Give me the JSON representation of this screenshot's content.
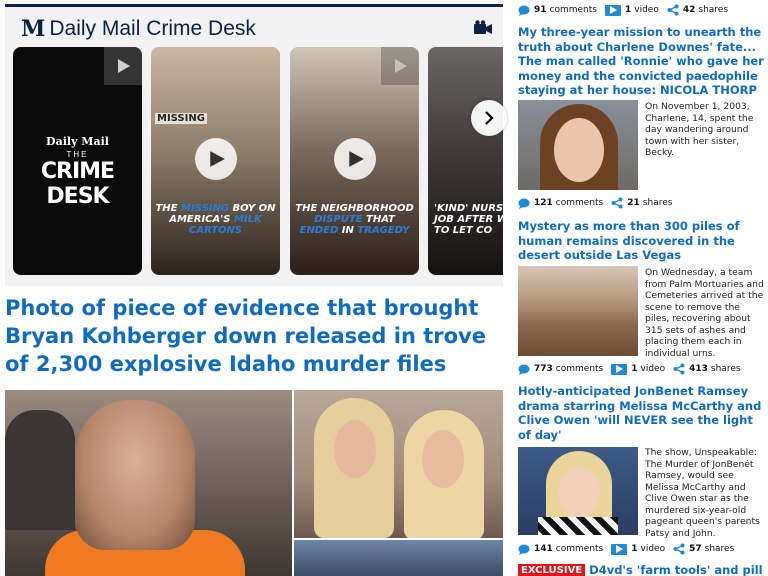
{
  "crime_desk": {
    "title": "Daily Mail Crime Desk",
    "logo_mark": "M",
    "cards": [
      {
        "logo_small": "Daily Mail",
        "logo_the": "THE",
        "logo_main": "CRIME DESK"
      },
      {
        "label_missing": "MISSING",
        "caption_pre": "THE ",
        "caption_hl": "MISSING",
        "caption_post": " BOY ON AMERICA'S ",
        "caption_hl2": "MILK CARTONS"
      },
      {
        "caption_pre": "THE NEIGHBORHOOD ",
        "caption_hl": "DISPUTE",
        "caption_mid": " THAT ",
        "caption_hl2": "ENDED",
        "caption_post": " IN ",
        "caption_hl3": "TRAGEDY"
      },
      {
        "caption_1": "'KIND' NURSE",
        "caption_2": "JOB AFTER W",
        "caption_3": "TO LET CO"
      }
    ]
  },
  "main_headline": "Photo of piece of evidence that brought Bryan Kohberger down released in trove of 2,300 explosive Idaho murder files",
  "sidebar": {
    "stories": [
      {
        "comments": "91",
        "comments_label": "comments",
        "videos": "1",
        "videos_label": "video",
        "shares": "42",
        "shares_label": "shares"
      },
      {
        "title": "My three-year mission to unearth the truth about Charlene Downes' fate... The man called 'Ronnie' who gave her money and the convicted paedophile staying at her house: NICOLA THORP",
        "desc": "On November 1, 2003, Charlene, 14, spent the day wandering around town with her sister, Becky.",
        "comments": "121",
        "comments_label": "comments",
        "shares": "21",
        "shares_label": "shares"
      },
      {
        "title": "Mystery as more than 300 piles of human remains discovered in the desert outside Las Vegas",
        "desc": "On Wednesday, a team from Palm Mortuaries and Cemeteries arrived at the scene to remove the piles, recovering about 315 sets of ashes and placing them each in individual urns.",
        "comments": "773",
        "comments_label": "comments",
        "videos": "1",
        "videos_label": "video",
        "shares": "413",
        "shares_label": "shares"
      },
      {
        "title": "Hotly-anticipated JonBenet Ramsey drama starring Melissa McCarthy and Clive Owen 'will NEVER see the light of day'",
        "desc": "The show, Unspeakable: The Murder of JonBenét Ramsey, would see Melissa McCarthy and Clive Owen star as the murdered six-year-old pageant queen's parents Patsy and John.",
        "comments": "141",
        "comments_label": "comments",
        "videos": "1",
        "videos_label": "video",
        "shares": "57",
        "shares_label": "shares"
      }
    ],
    "exclusive_badge": "EXCLUSIVE",
    "exclusive_title": "D4vd's 'farm tools' and pill"
  },
  "colors": {
    "link_blue": "#0e6bc1",
    "navy": "#0d2143",
    "exclusive_red": "#e0151a",
    "icon_blue": "#1f8bd6"
  },
  "icons": [
    "video-camera-icon",
    "play-icon",
    "chevron-right-icon",
    "comment-bubble-icon",
    "video-icon",
    "share-icon"
  ]
}
